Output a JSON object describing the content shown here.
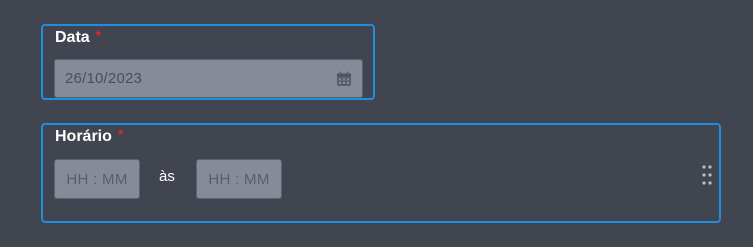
{
  "date_field": {
    "label": "Data",
    "required_mark": "*",
    "value": "26/10/2023",
    "icon": "calendar-icon"
  },
  "time_field": {
    "label": "Horário",
    "required_mark": "*",
    "start_placeholder": "HH : MM",
    "separator": "às",
    "end_placeholder": "HH : MM",
    "drag_icon": "drag-handle-icon"
  },
  "colors": {
    "background": "#414550",
    "border_accent": "#1f8de0",
    "input_fill": "#868b9a",
    "required": "#e0262c"
  }
}
